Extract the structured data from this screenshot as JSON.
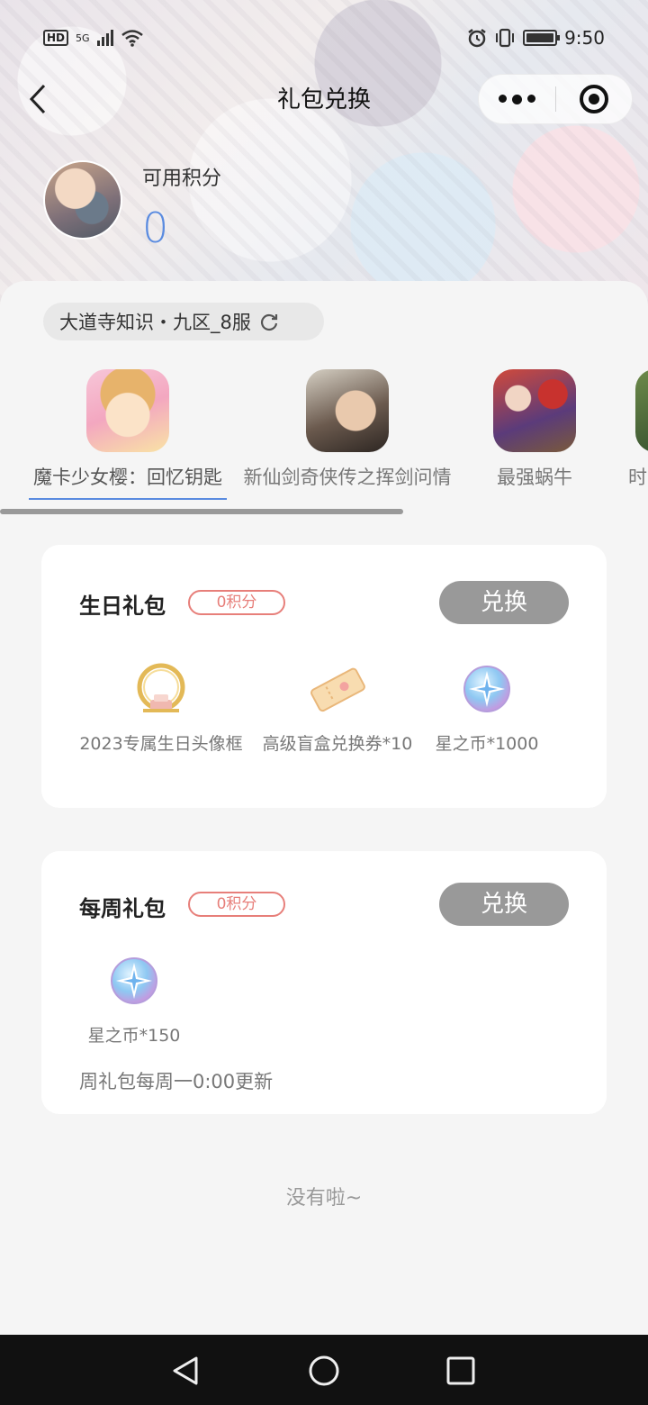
{
  "status_bar": {
    "network_badge": "HD",
    "network_type": "5G",
    "time": "9:50",
    "icons": [
      "signal-icon",
      "wifi-icon",
      "alarm-icon",
      "vibrate-icon",
      "battery-icon"
    ]
  },
  "nav": {
    "title": "礼包兑换",
    "icons": [
      "back-arrow-icon",
      "more-dots-icon",
      "target-icon"
    ]
  },
  "profile": {
    "points_label": "可用积分",
    "points_value": "0"
  },
  "server": {
    "name": "大道寺知识・九区_8服",
    "icon": "refresh-icon"
  },
  "games": [
    {
      "label": "魔卡少女樱：回忆钥匙",
      "active": true
    },
    {
      "label": "新仙剑奇侠传之挥剑问情",
      "active": false
    },
    {
      "label": "最强蜗牛",
      "active": false
    },
    {
      "label": "时",
      "active": false
    }
  ],
  "packs": [
    {
      "title": "生日礼包",
      "cost": "0积分",
      "button": "兑换",
      "rewards": [
        {
          "label": "2023专属生日头像框",
          "icon": "birthday-frame-icon"
        },
        {
          "label": "高级盲盒兑换券*10",
          "icon": "ticket-icon"
        },
        {
          "label": "星之币*1000",
          "icon": "star-coin-icon"
        }
      ],
      "note": ""
    },
    {
      "title": "每周礼包",
      "cost": "0积分",
      "button": "兑换",
      "rewards": [
        {
          "label": "星之币*150",
          "icon": "star-coin-icon"
        }
      ],
      "note": "周礼包每周一0:00更新"
    }
  ],
  "end_text": "没有啦~",
  "colors": {
    "accent": "#5a8be0",
    "cost_badge": "#e77f7a",
    "button_disabled": "#999999",
    "system_nav": "#111111"
  }
}
